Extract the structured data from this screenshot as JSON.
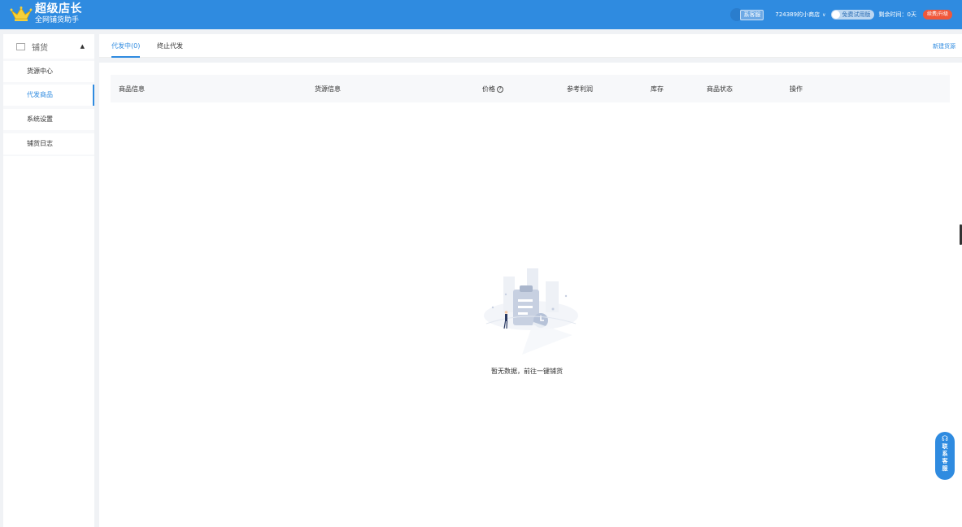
{
  "header": {
    "brand_title": "超级店长",
    "brand_subtitle": "全网铺货助手",
    "customer_service_label": "系客服",
    "shop_name": "724389的小商店",
    "trial_label": "免费试用版",
    "remaining_label": "剩余时间：0天",
    "renew_label": "续费/升级"
  },
  "sidebar": {
    "group_label": "铺货",
    "items": [
      {
        "label": "货源中心"
      },
      {
        "label": "代发商品"
      },
      {
        "label": "系统设置"
      },
      {
        "label": "铺货日志"
      }
    ],
    "active_index": 1
  },
  "tabs": [
    {
      "label": "代发中(0)"
    },
    {
      "label": "终止代发"
    }
  ],
  "new_source_label": "新建货源",
  "table": {
    "columns": [
      {
        "label": "商品信息"
      },
      {
        "label": "货源信息"
      },
      {
        "label": "价格"
      },
      {
        "label": "参考利润"
      },
      {
        "label": "库存"
      },
      {
        "label": "商品状态"
      },
      {
        "label": "操作"
      }
    ]
  },
  "empty": {
    "text": "暂无数据，",
    "link": "前往一键铺货"
  },
  "float_cs": {
    "chars": [
      "联",
      "系",
      "客",
      "服"
    ]
  },
  "colors": {
    "primary": "#2f8be0",
    "renew": "#f0573a"
  }
}
